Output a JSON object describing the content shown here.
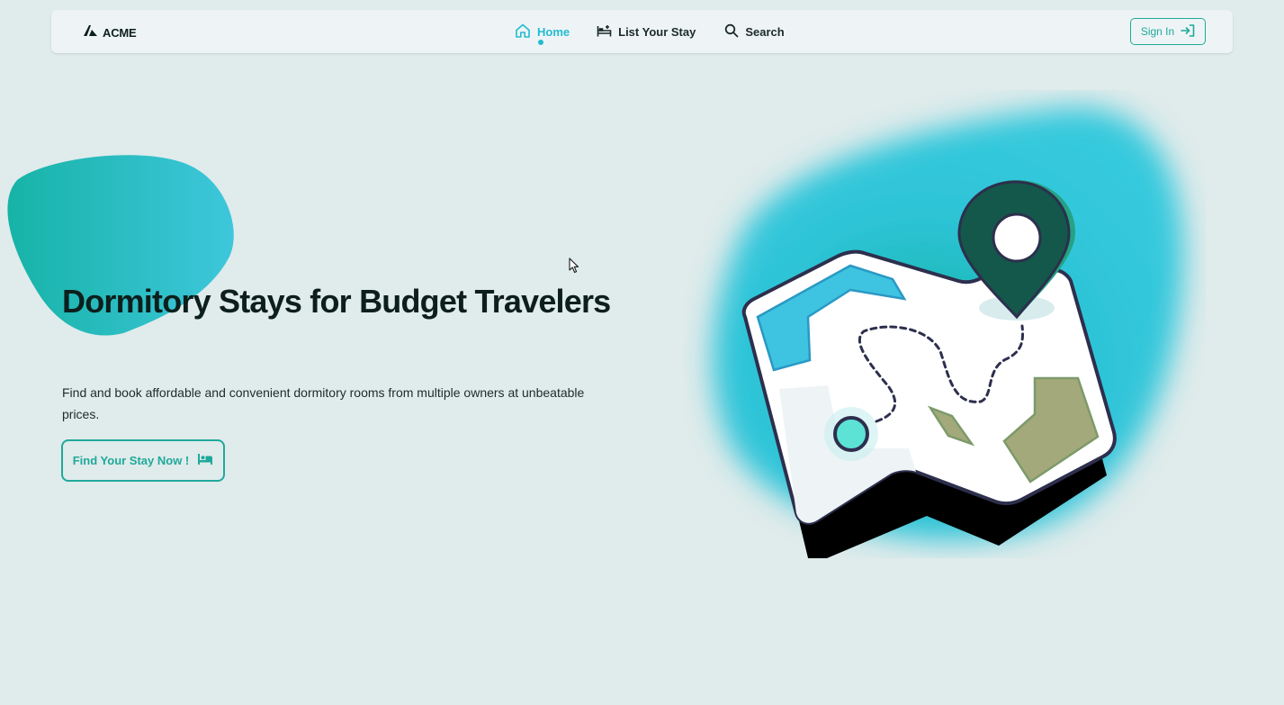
{
  "nav": {
    "brand": "ACME",
    "links": [
      {
        "label": "Home",
        "icon": "home-icon",
        "active": true
      },
      {
        "label": "List Your Stay",
        "icon": "bed-plus-icon"
      },
      {
        "label": "Search",
        "icon": "search-icon"
      }
    ],
    "signin_label": "Sign In"
  },
  "hero": {
    "title": "Dormitory Stays for Budget Travelers",
    "description": "Find and book affordable and convenient dormitory rooms from multiple owners at unbeatable prices.",
    "cta_label": "Find Your Stay Now !"
  },
  "colors": {
    "accent": "#22bcd0",
    "teal": "#1fa99a",
    "background": "#e0ebeb",
    "pin": "#13584a"
  }
}
